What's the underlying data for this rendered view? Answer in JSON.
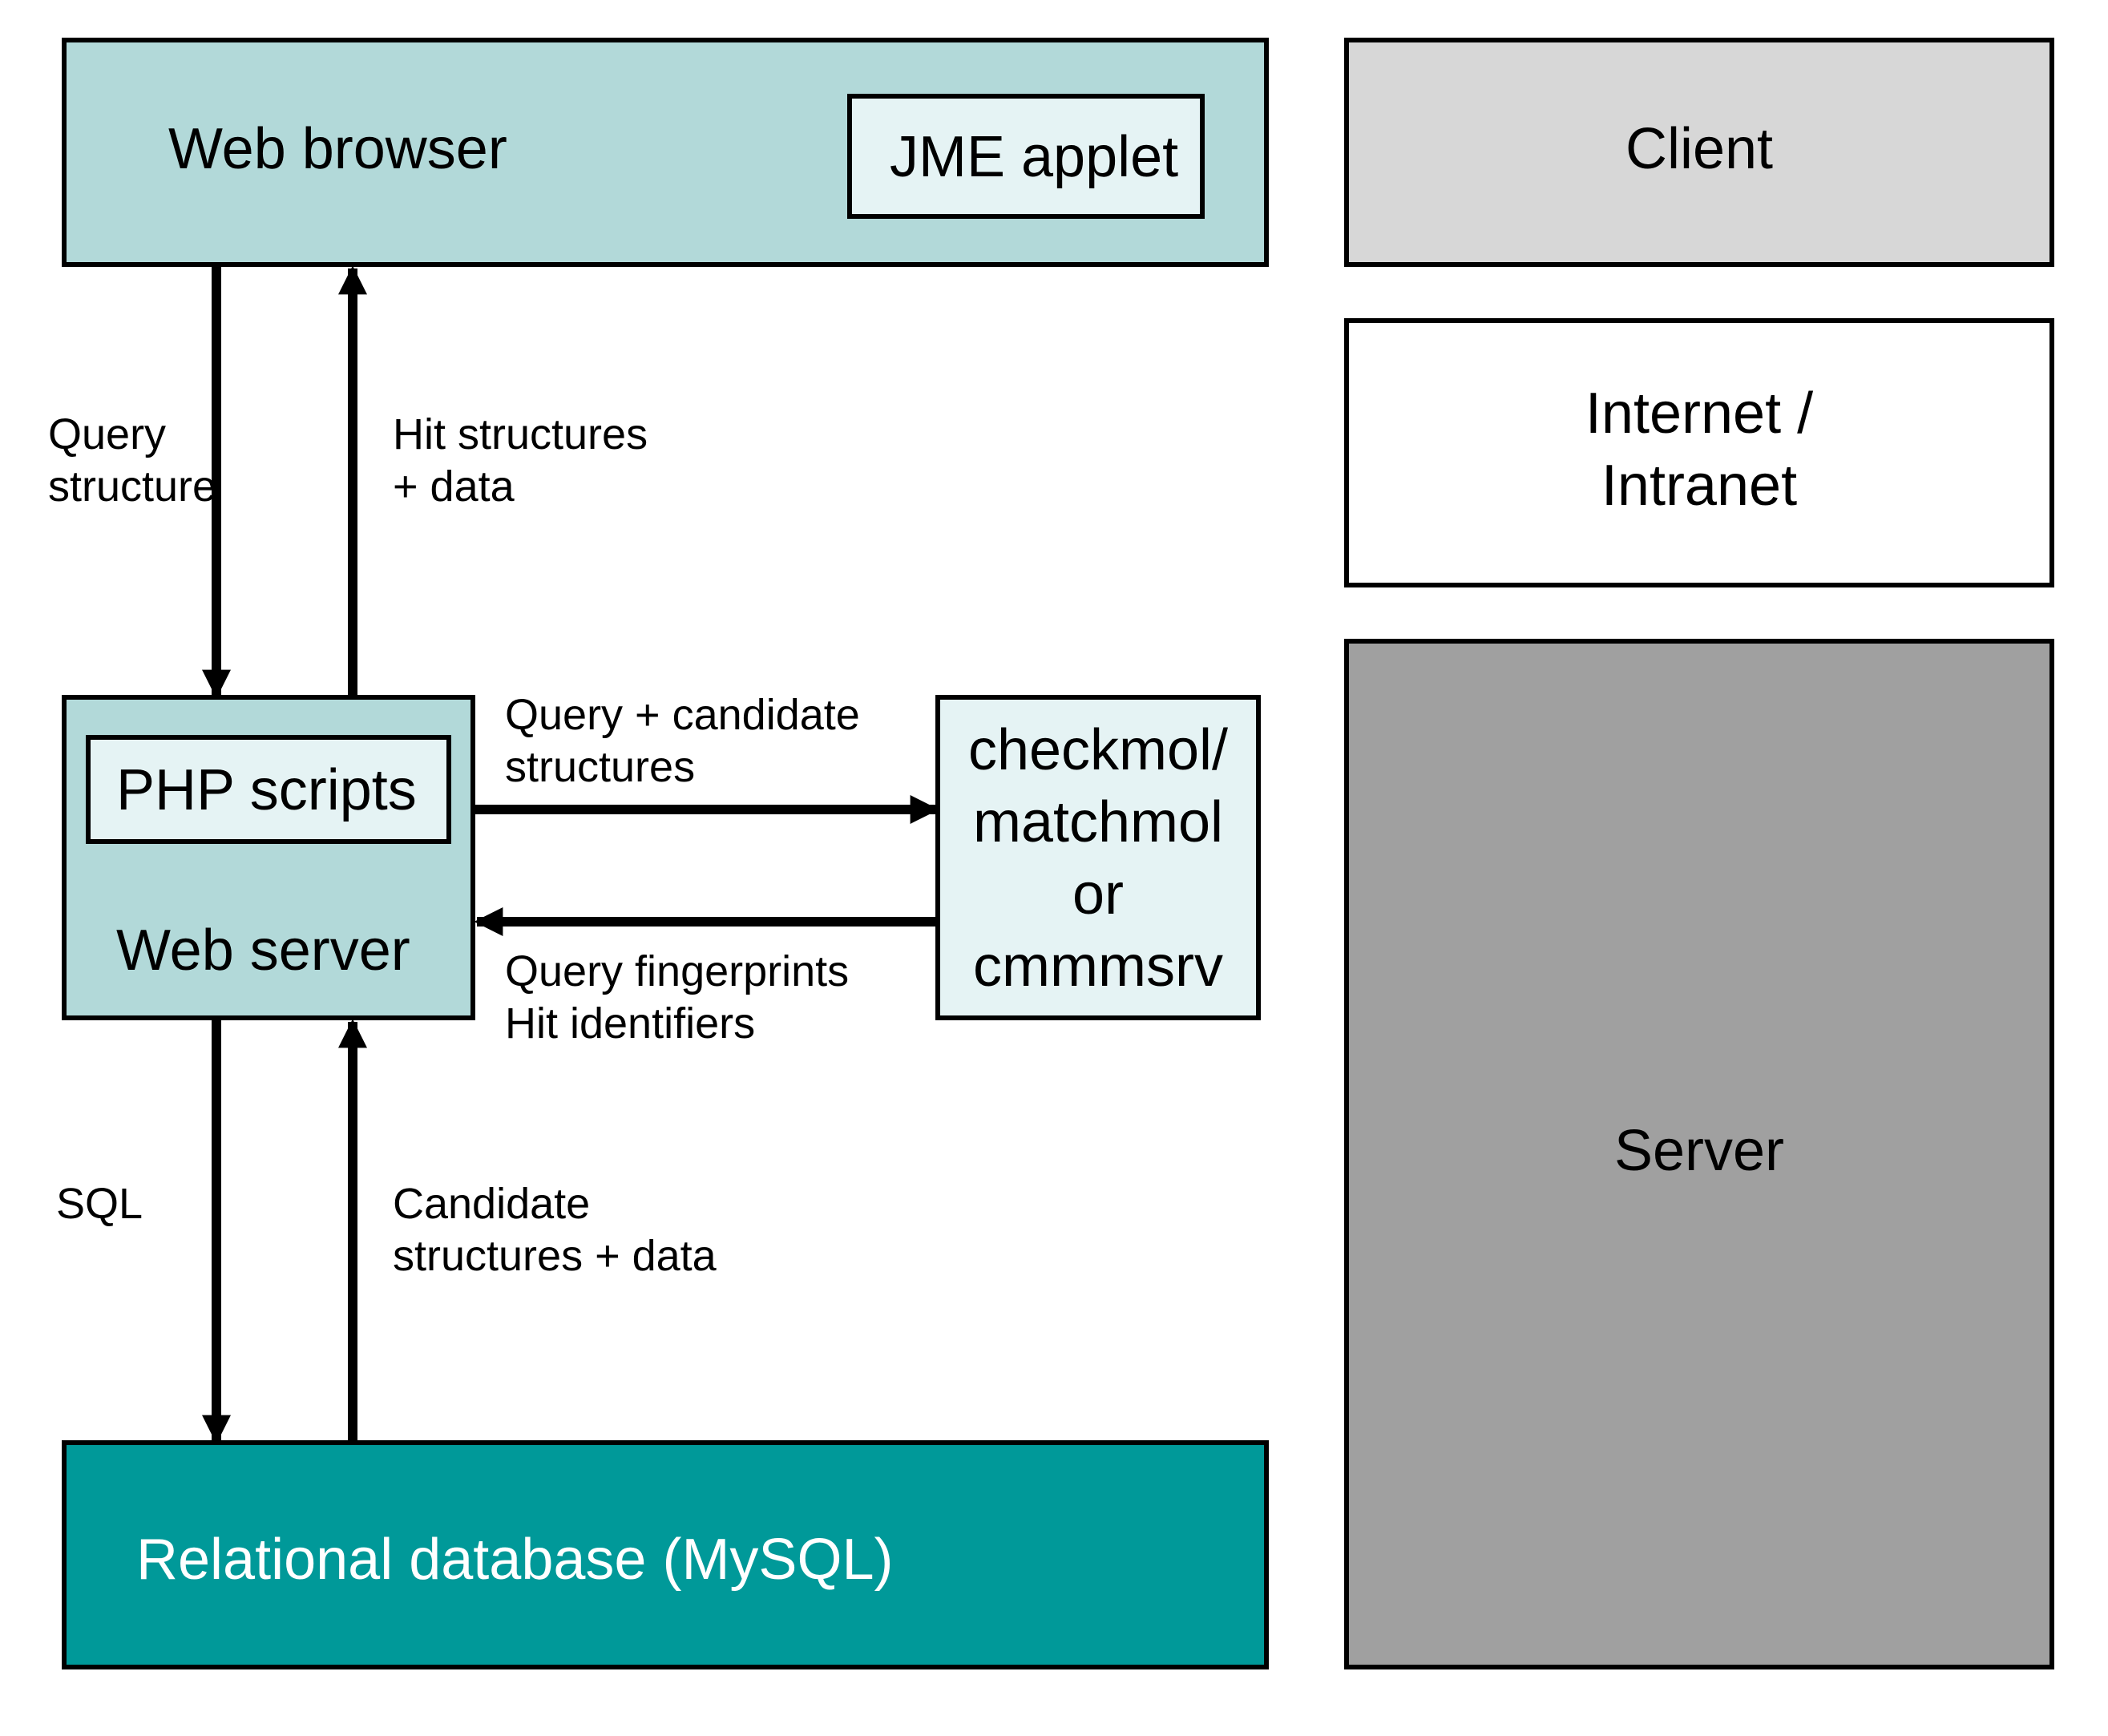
{
  "diagram": {
    "nodes": {
      "browser": {
        "label": "Web browser",
        "inner": {
          "label": "JME applet"
        }
      },
      "webserver": {
        "label": "Web server",
        "inner": {
          "label": "PHP scripts"
        }
      },
      "matcher": {
        "line1": "checkmol/",
        "line2": "matchmol",
        "line3": "or",
        "line4": "cmmmsrv"
      },
      "database": {
        "label": "Relational database (MySQL)"
      }
    },
    "legend": {
      "client": "Client",
      "network1": "Internet /",
      "network2": "Intranet",
      "server": "Server"
    },
    "edges": {
      "browser_to_server_1": "Query",
      "browser_to_server_2": "structure",
      "server_to_browser_1": "Hit structures",
      "server_to_browser_2": "+ data",
      "server_to_matcher_1": "Query + candidate",
      "server_to_matcher_2": "structures",
      "matcher_to_server_1": "Query fingerprints",
      "matcher_to_server_2": "Hit identifiers",
      "server_to_db": "SQL",
      "db_to_server_1": "Candidate",
      "db_to_server_2": "structures + data"
    }
  },
  "colors": {
    "teal_light": "#b2d9d9",
    "teal_pale": "#e5f3f4",
    "teal_dark": "#009999",
    "grey_light": "#d7d7d7",
    "grey_mid": "#a0a0a0",
    "black": "#000000"
  }
}
